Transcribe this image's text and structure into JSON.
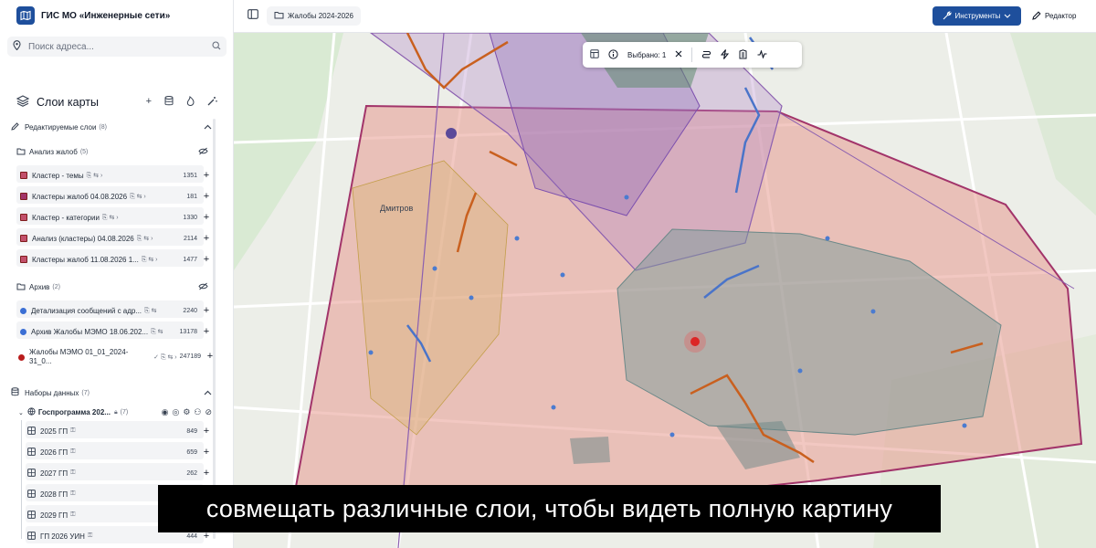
{
  "app": {
    "title": "ГИС МО «Инженерные сети»"
  },
  "search": {
    "placeholder": "Поиск адреса..."
  },
  "layers": {
    "title": "Слои карты"
  },
  "editable": {
    "label": "Редактируемые слои",
    "count": "(8)"
  },
  "analysis": {
    "label": "Анализ жалоб",
    "count": "(5)",
    "items": [
      {
        "name": "Кластер - темы",
        "count": "1351",
        "color": "#c2506b"
      },
      {
        "name": "Кластеры жалоб 04.08.2026",
        "count": "181",
        "color": "#a2346a"
      },
      {
        "name": "Кластер - категории",
        "count": "1330",
        "color": "#c2506b"
      },
      {
        "name": "Анализ (кластеры) 04.08.2026",
        "count": "2114",
        "color": "#c2506b"
      },
      {
        "name": "Кластеры жалоб 11.08.2026 1...",
        "count": "1477",
        "color": "#c2506b"
      }
    ]
  },
  "archive": {
    "label": "Архив",
    "count": "(2)",
    "items": [
      {
        "name": "Детализация сообщений с адр...",
        "count": "2240",
        "color": "#3b6fd4"
      },
      {
        "name": "Архив Жалобы МЭМО 18.06.202...",
        "count": "13178",
        "color": "#3b6fd4"
      }
    ]
  },
  "complaints": {
    "line1": "Жалобы МЭМО 01_01_2024-",
    "line2": "31_0...",
    "count": "247189",
    "color": "#b91c1c"
  },
  "datasets": {
    "label": "Наборы данных",
    "count": "(7)"
  },
  "gosprog": {
    "label": "Госпрограмма 202...",
    "count": "(7)",
    "items": [
      {
        "name": "2025 ГП",
        "count": "849"
      },
      {
        "name": "2026 ГП",
        "count": "659"
      },
      {
        "name": "2027 ГП",
        "count": "262"
      },
      {
        "name": "2028 ГП",
        "count": ""
      },
      {
        "name": "2029 ГП",
        "count": ""
      },
      {
        "name": "ГП 2026 УИН",
        "count": "444"
      }
    ]
  },
  "topbar": {
    "breadcrumb": "Жалобы 2024-2026",
    "tools_label": "Инструменты",
    "editor_label": "Редактор"
  },
  "selection": {
    "label": "Выбрано: 1"
  },
  "map": {
    "label_city": "Дмитров"
  },
  "subtitle": {
    "text": "совмещать различные слои, чтобы видеть полную картину"
  }
}
